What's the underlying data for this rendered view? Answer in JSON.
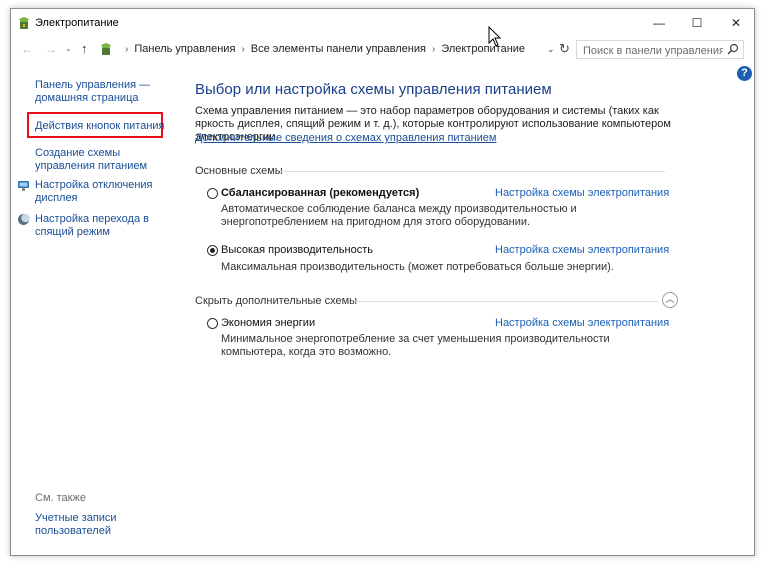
{
  "window": {
    "title": "Электропитание",
    "controls": {
      "minimize": "—",
      "maximize": "☐",
      "close": "✕"
    }
  },
  "navbar": {
    "breadcrumbs": [
      "Панель управления",
      "Все элементы панели управления",
      "Электропитание"
    ],
    "search_placeholder": "Поиск в панели управления"
  },
  "sidebar": {
    "home_link": "Панель управления — домашняя страница",
    "power_buttons_link": "Действия кнопок питания",
    "create_plan_link": "Создание схемы управления питанием",
    "display_off_link": "Настройка отключения дисплея",
    "sleep_link": "Настройка перехода в спящий режим",
    "see_also_label": "См. также",
    "user_accounts_link": "Учетные записи пользователей"
  },
  "main": {
    "title": "Выбор или настройка схемы управления питанием",
    "description": "Схема управления питанием — это набор параметров оборудования и системы (таких как яркость дисплея, спящий режим и т. д.), которые контролируют использование компьютером электроэнергии.",
    "more_info_link": "Дополнительные сведения о схемах управления питанием",
    "main_plans_label": "Основные схемы",
    "hidden_plans_label": "Скрыть дополнительные схемы",
    "plans": [
      {
        "name": "Сбалансированная (рекомендуется)",
        "selected": false,
        "link": "Настройка схемы электропитания",
        "description": "Автоматическое соблюдение баланса между производительностью и энергопотреблением на пригодном для этого оборудовании."
      },
      {
        "name": "Высокая производительность",
        "selected": true,
        "link": "Настройка схемы электропитания",
        "description": "Максимальная производительность (может потребоваться больше энергии)."
      },
      {
        "name": "Экономия энергии",
        "selected": false,
        "link": "Настройка схемы электропитания",
        "description": "Минимальное энергопотребление за счет уменьшения производительности компьютера, когда это возможно."
      }
    ]
  },
  "colors": {
    "link": "#1a4e96",
    "title": "#1a3f8a",
    "highlight": "#e8101a",
    "help": "#1a5fb4"
  }
}
